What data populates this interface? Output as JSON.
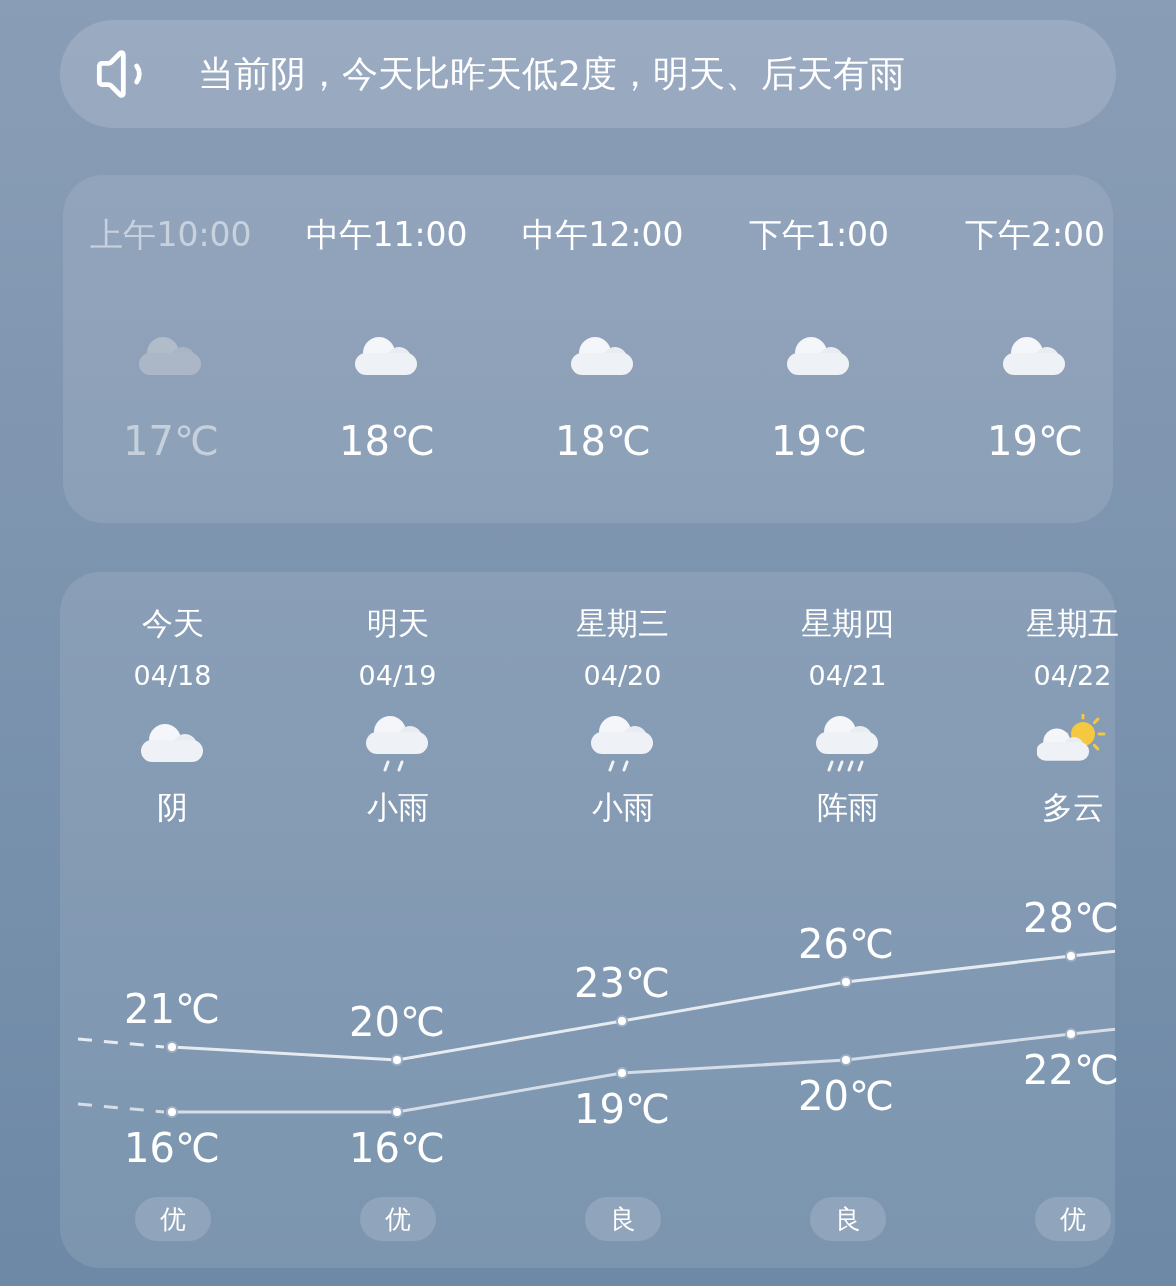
{
  "banner": {
    "text": "当前阴，今天比昨天低2度，明天、后天有雨"
  },
  "hourly": [
    {
      "time": "上午10:00",
      "kind": "cloudy",
      "temp": "17℃",
      "past": true
    },
    {
      "time": "中午11:00",
      "kind": "cloudy",
      "temp": "18℃",
      "past": false
    },
    {
      "time": "中午12:00",
      "kind": "cloudy",
      "temp": "18℃",
      "past": false
    },
    {
      "time": "下午1:00",
      "kind": "cloudy",
      "temp": "19℃",
      "past": false
    },
    {
      "time": "下午2:00",
      "kind": "cloudy",
      "temp": "19℃",
      "past": false
    }
  ],
  "daily": [
    {
      "day": "今天",
      "date": "04/18",
      "kind": "cloudy",
      "condition": "阴",
      "aqi": "优"
    },
    {
      "day": "明天",
      "date": "04/19",
      "kind": "rain",
      "condition": "小雨",
      "aqi": "优"
    },
    {
      "day": "星期三",
      "date": "04/20",
      "kind": "rain",
      "condition": "小雨",
      "aqi": "良"
    },
    {
      "day": "星期四",
      "date": "04/21",
      "kind": "shower",
      "condition": "阵雨",
      "aqi": "良"
    },
    {
      "day": "星期五",
      "date": "04/22",
      "kind": "sunny",
      "condition": "多云",
      "aqi": "优"
    }
  ],
  "chart_data": {
    "type": "line",
    "data_labels": true,
    "series": [
      {
        "color": "#e6ebf2",
        "marker": "circle",
        "values": [
          21,
          20,
          23,
          26,
          28
        ],
        "value_labels": [
          "21℃",
          "20℃",
          "23℃",
          "26℃",
          "28℃"
        ]
      },
      {
        "color": "#d5dde8",
        "marker": "circle",
        "values": [
          16,
          16,
          19,
          20,
          22
        ],
        "value_labels": [
          "16℃",
          "16℃",
          "19℃",
          "20℃",
          "22℃"
        ]
      }
    ]
  }
}
